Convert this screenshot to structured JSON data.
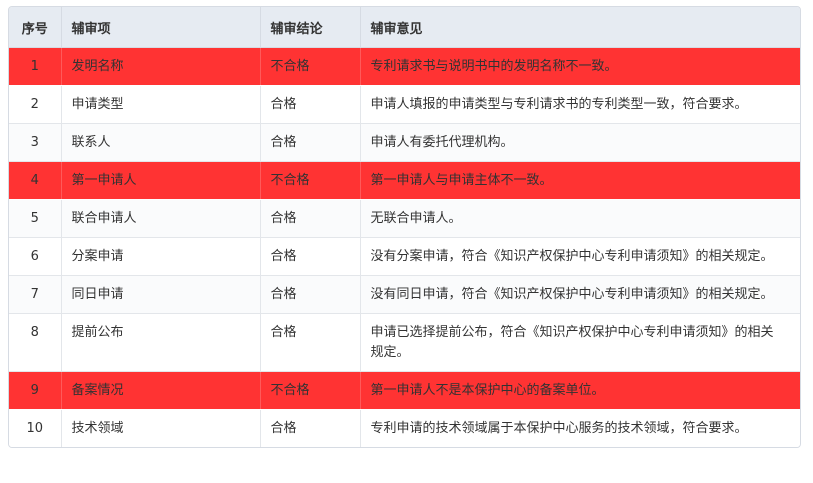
{
  "table": {
    "headers": [
      "序号",
      "辅审项",
      "辅审结论",
      "辅审意见"
    ],
    "rows": [
      {
        "index": "1",
        "item": "发明名称",
        "result": "不合格",
        "opinion": "专利请求书与说明书中的发明名称不一致。",
        "fail": true
      },
      {
        "index": "2",
        "item": "申请类型",
        "result": "合格",
        "opinion": "申请人填报的申请类型与专利请求书的专利类型一致，符合要求。",
        "fail": false
      },
      {
        "index": "3",
        "item": "联系人",
        "result": "合格",
        "opinion": "申请人有委托代理机构。",
        "fail": false
      },
      {
        "index": "4",
        "item": "第一申请人",
        "result": "不合格",
        "opinion": "第一申请人与申请主体不一致。",
        "fail": true
      },
      {
        "index": "5",
        "item": "联合申请人",
        "result": "合格",
        "opinion": "无联合申请人。",
        "fail": false
      },
      {
        "index": "6",
        "item": "分案申请",
        "result": "合格",
        "opinion": "没有分案申请，符合《知识产权保护中心专利申请须知》的相关规定。",
        "fail": false
      },
      {
        "index": "7",
        "item": "同日申请",
        "result": "合格",
        "opinion": "没有同日申请，符合《知识产权保护中心专利申请须知》的相关规定。",
        "fail": false
      },
      {
        "index": "8",
        "item": "提前公布",
        "result": "合格",
        "opinion": "申请已选择提前公布，符合《知识产权保护中心专利申请须知》的相关规定。",
        "fail": false
      },
      {
        "index": "9",
        "item": "备案情况",
        "result": "不合格",
        "opinion": "第一申请人不是本保护中心的备案单位。",
        "fail": true
      },
      {
        "index": "10",
        "item": "技术领域",
        "result": "合格",
        "opinion": "专利申请的技术领域属于本保护中心服务的技术领域，符合要求。",
        "fail": false
      }
    ]
  },
  "colors": {
    "fail_row": "#ff3333",
    "header_bg": "#e6ebf2"
  }
}
